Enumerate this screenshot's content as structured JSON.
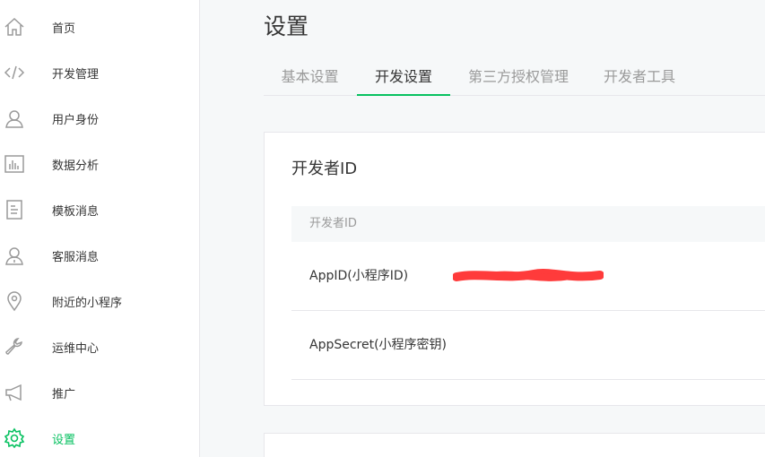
{
  "sidebar": {
    "items": [
      {
        "label": "首页",
        "icon": "home-icon"
      },
      {
        "label": "开发管理",
        "icon": "code-icon"
      },
      {
        "label": "用户身份",
        "icon": "user-icon"
      },
      {
        "label": "数据分析",
        "icon": "chart-icon"
      },
      {
        "label": "模板消息",
        "icon": "document-icon"
      },
      {
        "label": "客服消息",
        "icon": "service-icon"
      },
      {
        "label": "附近的小程序",
        "icon": "location-icon"
      },
      {
        "label": "运维中心",
        "icon": "wrench-icon"
      },
      {
        "label": "推广",
        "icon": "megaphone-icon"
      },
      {
        "label": "设置",
        "icon": "gear-icon",
        "active": true
      }
    ]
  },
  "header": {
    "title": "设置"
  },
  "tabs": [
    {
      "label": "基本设置"
    },
    {
      "label": "开发设置",
      "active": true
    },
    {
      "label": "第三方授权管理"
    },
    {
      "label": "开发者工具"
    }
  ],
  "developer_card": {
    "title": "开发者ID",
    "table_header": "开发者ID",
    "rows": [
      {
        "label": "AppID(小程序ID)"
      },
      {
        "label": "AppSecret(小程序密钥)"
      }
    ]
  },
  "colors": {
    "accent": "#07c160",
    "icon": "#9a9a9a",
    "text": "#353535",
    "redaction": "#ff3b3b"
  }
}
